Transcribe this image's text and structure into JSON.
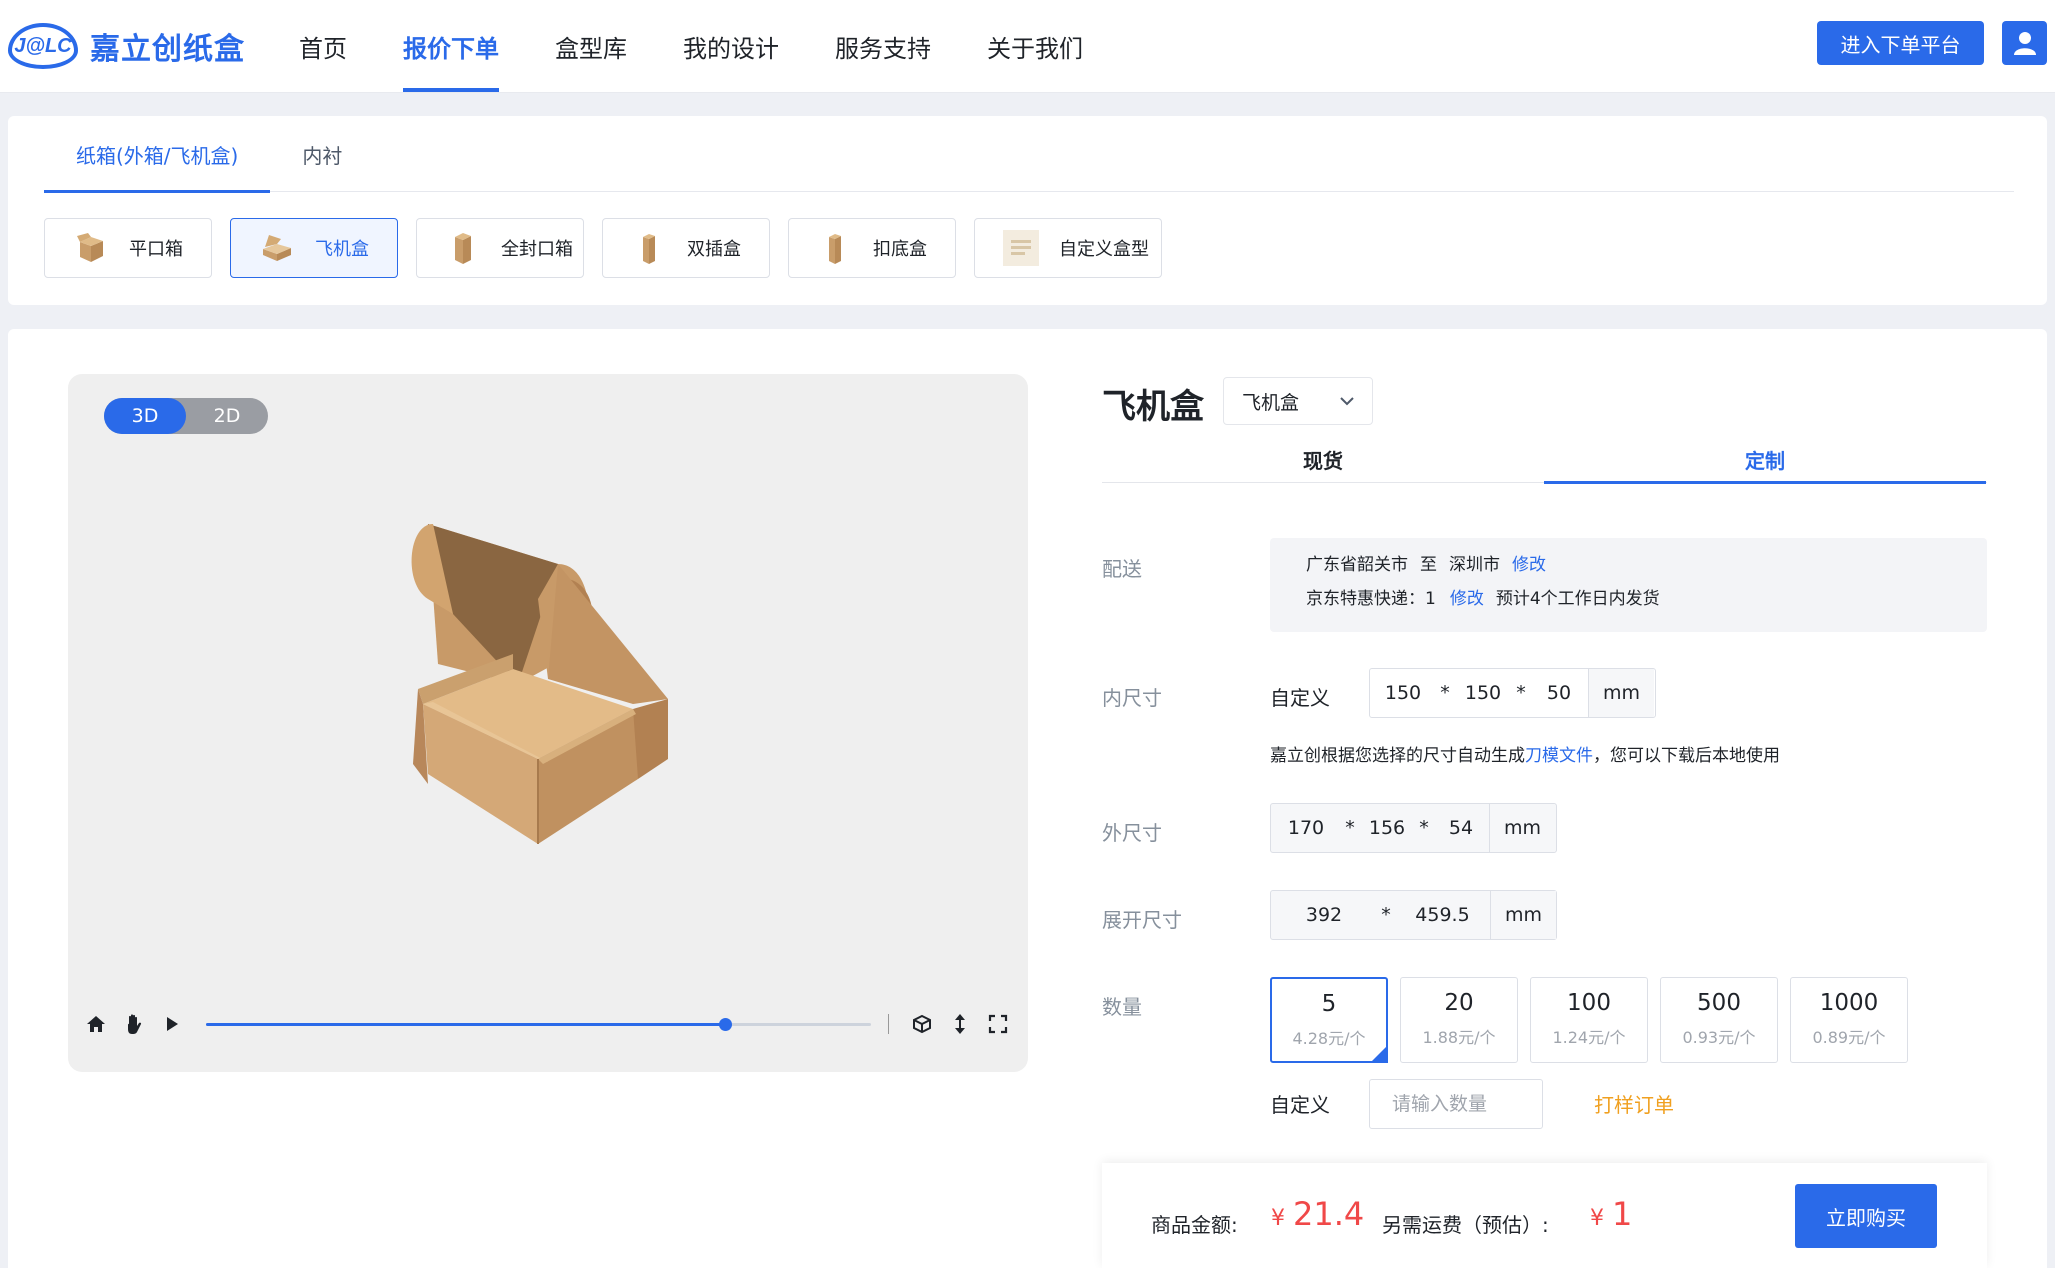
{
  "header": {
    "logo_mark": "J@LC",
    "logo_text": "嘉立创纸盒",
    "nav": [
      "首页",
      "报价下单",
      "盒型库",
      "我的设计",
      "服务支持",
      "关于我们"
    ],
    "active_nav": "报价下单",
    "enter_button": "进入下单平台"
  },
  "categories": {
    "tabs": [
      "纸箱(外箱/飞机盒)",
      "内衬"
    ],
    "active_tab": "纸箱(外箱/飞机盒)",
    "box_types": [
      "平口箱",
      "飞机盒",
      "全封口箱",
      "双插盒",
      "扣底盒",
      "自定义盒型"
    ],
    "active_box_type": "飞机盒"
  },
  "viewer": {
    "modes": [
      "3D",
      "2D"
    ],
    "active_mode": "3D",
    "progress": 0.78
  },
  "product": {
    "title": "飞机盒",
    "select_value": "飞机盒",
    "tabs": [
      "现货",
      "定制"
    ],
    "active_tab": "定制"
  },
  "shipping": {
    "label": "配送",
    "from": "广东省韶关市",
    "to_word": "至",
    "to": "深圳市",
    "modify": "修改",
    "courier": "京东特惠快递：1",
    "courier_modify": "修改",
    "eta": "预计4个工作日内发货"
  },
  "inner_size": {
    "label": "内尺寸",
    "mode": "自定义",
    "values": [
      "150",
      "150",
      "50"
    ],
    "sep": "*",
    "unit": "mm",
    "hint_prefix": "嘉立创根据您选择的尺寸自动生成",
    "hint_link": "刀模文件",
    "hint_suffix": "，您可以下载后本地使用"
  },
  "outer_size": {
    "label": "外尺寸",
    "values": [
      "170",
      "156",
      "54"
    ],
    "sep": "*",
    "unit": "mm"
  },
  "unfold_size": {
    "label": "展开尺寸",
    "values": [
      "392",
      "459.5"
    ],
    "sep": "*",
    "unit": "mm"
  },
  "quantity": {
    "label": "数量",
    "options": [
      {
        "qty": "5",
        "price": "4.28元/个"
      },
      {
        "qty": "20",
        "price": "1.88元/个"
      },
      {
        "qty": "100",
        "price": "1.24元/个"
      },
      {
        "qty": "500",
        "price": "0.93元/个"
      },
      {
        "qty": "1000",
        "price": "0.89元/个"
      }
    ],
    "selected": "5",
    "custom_label": "自定义",
    "custom_placeholder": "请输入数量",
    "sample_link": "打样订单"
  },
  "summary": {
    "amount_label": "商品金额:",
    "currency": "¥",
    "amount": "21.4",
    "shipping_label": "另需运费（预估）:",
    "shipping": "1",
    "buy_button": "立即购买"
  },
  "colors": {
    "primary": "#2a6ae9",
    "price": "#f04848",
    "sample_link": "#f0a020"
  }
}
